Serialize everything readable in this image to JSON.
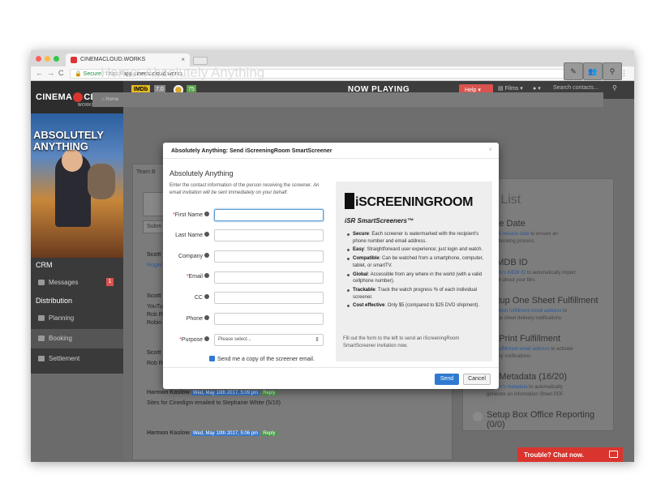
{
  "browser": {
    "tab_title": "CINEMACLOUD.WORKS",
    "secure_label": "Secure",
    "url_scheme": "https://",
    "url_host": "app.cinemacloud.works",
    "window_dots": [
      "#fc605c",
      "#fdbc40",
      "#34c84a"
    ]
  },
  "app": {
    "logo_pre": "CINEMA",
    "logo_post": "CLOUD",
    "logo_sub": "WORKS",
    "imdb_label": "IMDb",
    "imdb_score": "7.0",
    "rt_score": "75",
    "page_header": "NOW PLAYING",
    "help_label": "Help ▾",
    "films_label": "Films ▾",
    "user_label": "▾",
    "search_placeholder": "Search contacts..."
  },
  "sidebar": {
    "poster_title": "ABSOLUTELY ANYTHING",
    "crm_heading": "CRM",
    "messages_label": "Messages",
    "messages_count": "1",
    "distribution_heading": "Distribution",
    "items": [
      "Planning",
      "Booking",
      "Settlement"
    ]
  },
  "page": {
    "title": "Home: Absolutely Anything",
    "breadcrumb": "Home",
    "team_label": "Team B",
    "submit_label": "Subm",
    "feed": [
      {
        "name": "Scott",
        "text": "Roger"
      },
      {
        "name": "Scott",
        "text": "YouTu",
        "text2": "Rob R",
        "text3": "Robin"
      },
      {
        "name": "Scott",
        "text": "Rob R"
      },
      {
        "name": "Harmon Kaslow",
        "timestamp": "Wed, May 10th 2017, 5:09 pm",
        "reply": "Reply",
        "text": "Sites for Cinedigm emailed to Stephanie White (5/10)"
      },
      {
        "name": "Harmon Kaslow",
        "timestamp": "Wed, May 10th 2017, 5:06 pm",
        "reply": "Reply",
        "text": ""
      }
    ]
  },
  "setup": {
    "heading": "p List",
    "items": [
      {
        "title": "t the Date",
        "sub_link": "default release date",
        "sub_text": " to ensure an",
        "sub2": "ident booking process."
      },
      {
        "title": "d IMDB ID",
        "sub_link": "our film's IMDB ID",
        "sub_text": " to automatically import",
        "sub2": "mation about your film."
      },
      {
        "title": "Setup One Sheet Fulfillment",
        "sub_link": "one sheet fulfillment email address",
        "sub_text": " to",
        "sub2": "ate one sheet delivery notifications."
      },
      {
        "title": "up Print Fulfillment",
        "sub_link": "print fulfillment email address",
        "sub_text": " to activate",
        "sub2": "delivery notifications."
      },
      {
        "title": "up Metadata (16/20)",
        "sub_link": "our film's metadata",
        "sub_text": " to automatically",
        "sub2": "generate an Information Sheet PDF."
      },
      {
        "title": "Setup Box Office Reporting (0/0)",
        "sub_link": "",
        "sub_text": "",
        "sub2": ""
      }
    ]
  },
  "modal": {
    "title": "Absolutely Anything: Send iScreeningRoom SmartScreener",
    "close": "×",
    "subtitle": "Absolutely Anything",
    "info_1": "Enter the contact information of the person receiving the screener.",
    "info_2": "An email invitation will be sent immediately on your behalf.",
    "fields": [
      {
        "label": "First Name",
        "required": "*",
        "value": ""
      },
      {
        "label": "Last Name",
        "required": "",
        "value": ""
      },
      {
        "label": "Company",
        "required": "",
        "value": ""
      },
      {
        "label": "Email",
        "required": "*",
        "value": ""
      },
      {
        "label": "CC",
        "required": "",
        "value": ""
      },
      {
        "label": "Phone",
        "required": "",
        "value": ""
      },
      {
        "label": "Purpose",
        "required": "*",
        "value": "Please select..."
      }
    ],
    "checkbox_label": "Send me a copy of the screener email.",
    "send_label": "Send",
    "cancel_label": "Cancel"
  },
  "isr": {
    "logo_i": "i",
    "logo_rest": "SCREENINGROOM",
    "tagline": "iSR SmartScreeners™",
    "features": [
      {
        "bold": "Secure",
        "text": ": Each screener is watermarked with the recipient's phone number and email address."
      },
      {
        "bold": "Easy",
        "text": ": Straightforward user experience; just login and watch."
      },
      {
        "bold": "Compatible",
        "text": ": Can be watched from a smartphone, computer, tablet, or smartTV."
      },
      {
        "bold": "Global",
        "text": ": Accessible from any where in the world (with a valid cellphone number)."
      },
      {
        "bold": "Trackable",
        "text": ": Track the watch progress % of each individual screener."
      },
      {
        "bold": "Cost effective",
        "text": ": Only $5 (compared to $25 DVD shipment)."
      }
    ],
    "footer": "Fill out the form to the left to send an iScreeningRoom SmartScreener invitation now."
  },
  "chat": {
    "label": "Trouble? Chat now."
  }
}
